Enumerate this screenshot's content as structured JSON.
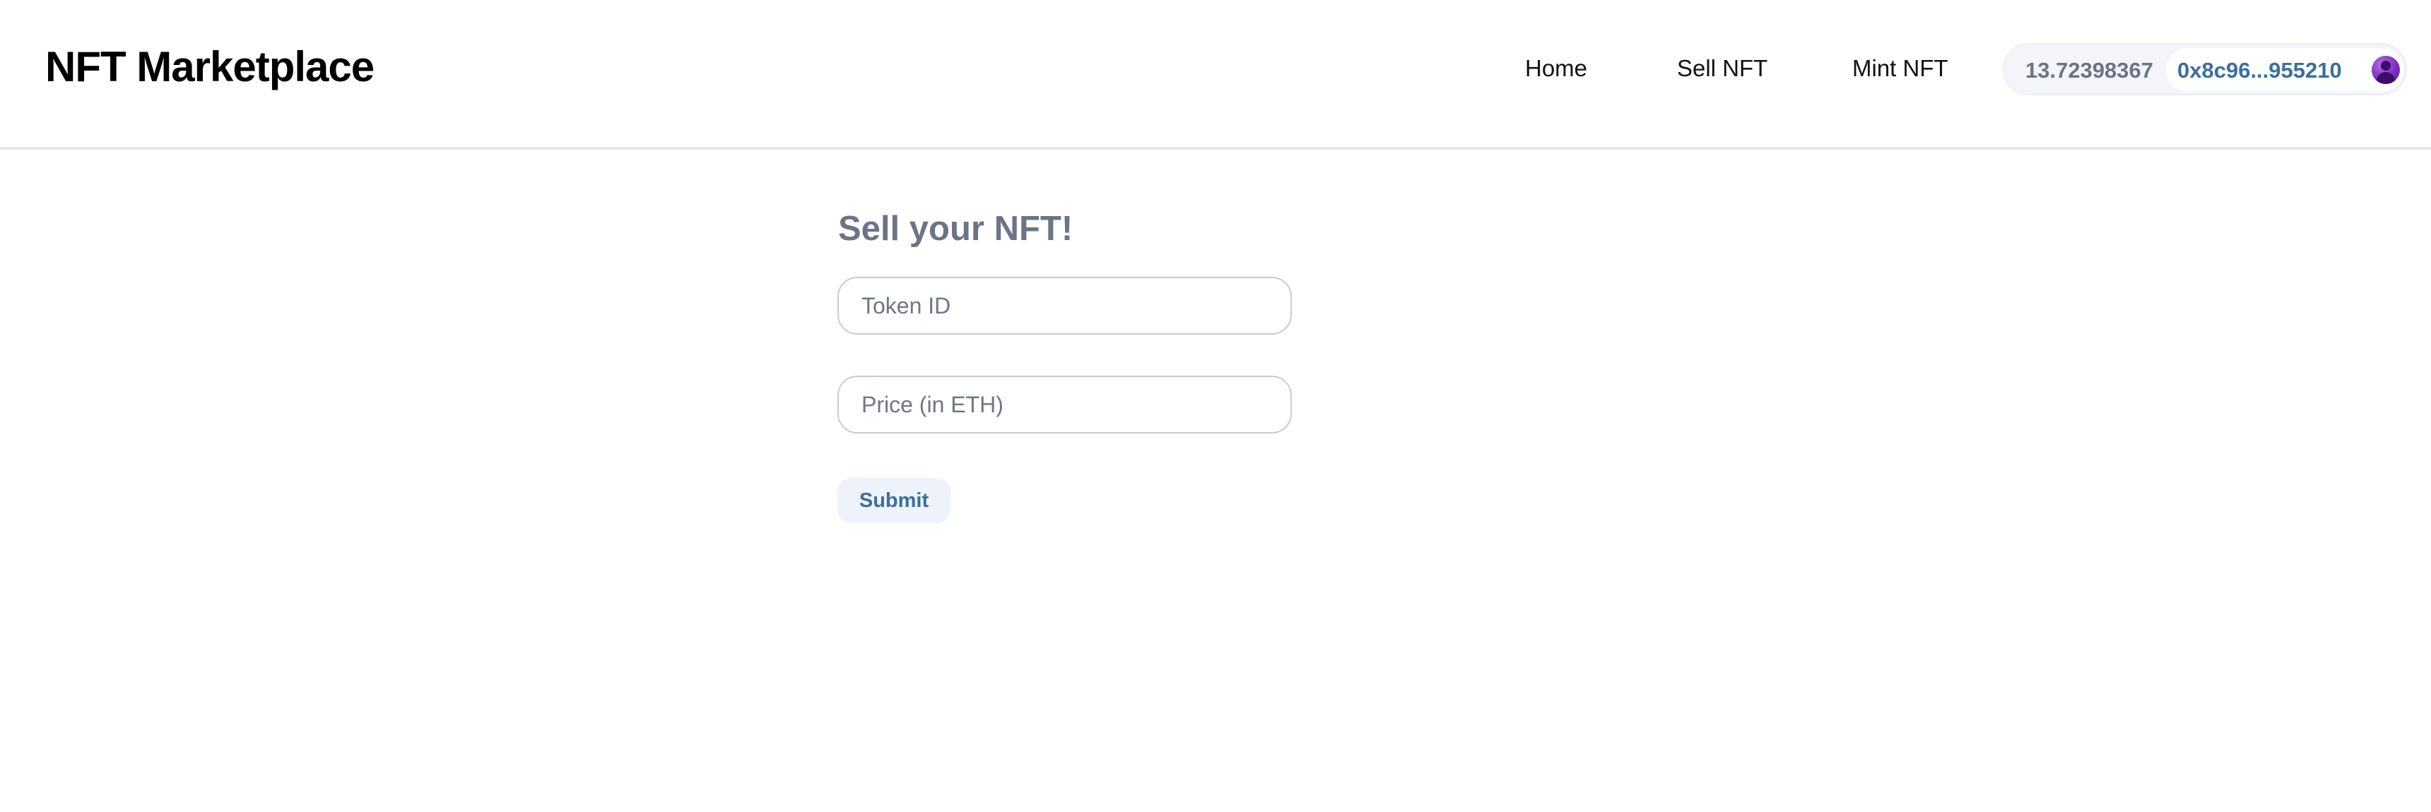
{
  "app": {
    "title": "NFT Marketplace"
  },
  "nav": {
    "items": [
      {
        "label": "Home"
      },
      {
        "label": "Sell NFT"
      },
      {
        "label": "Mint NFT"
      }
    ]
  },
  "wallet": {
    "balance": "13.72398367",
    "address": "0x8c96...955210",
    "avatar_icon": "user-avatar-icon",
    "avatar_color": "#7b2fbf"
  },
  "sell_form": {
    "title": "Sell your NFT!",
    "token_id": {
      "value": "",
      "placeholder": "Token ID"
    },
    "price": {
      "value": "",
      "placeholder": "Price (in ETH)"
    },
    "submit_label": "Submit"
  },
  "colors": {
    "accent": "#3a6f9c",
    "muted_text": "#6b7487",
    "wallet_bg": "#f4f5fa",
    "button_bg": "#eef2fb"
  }
}
